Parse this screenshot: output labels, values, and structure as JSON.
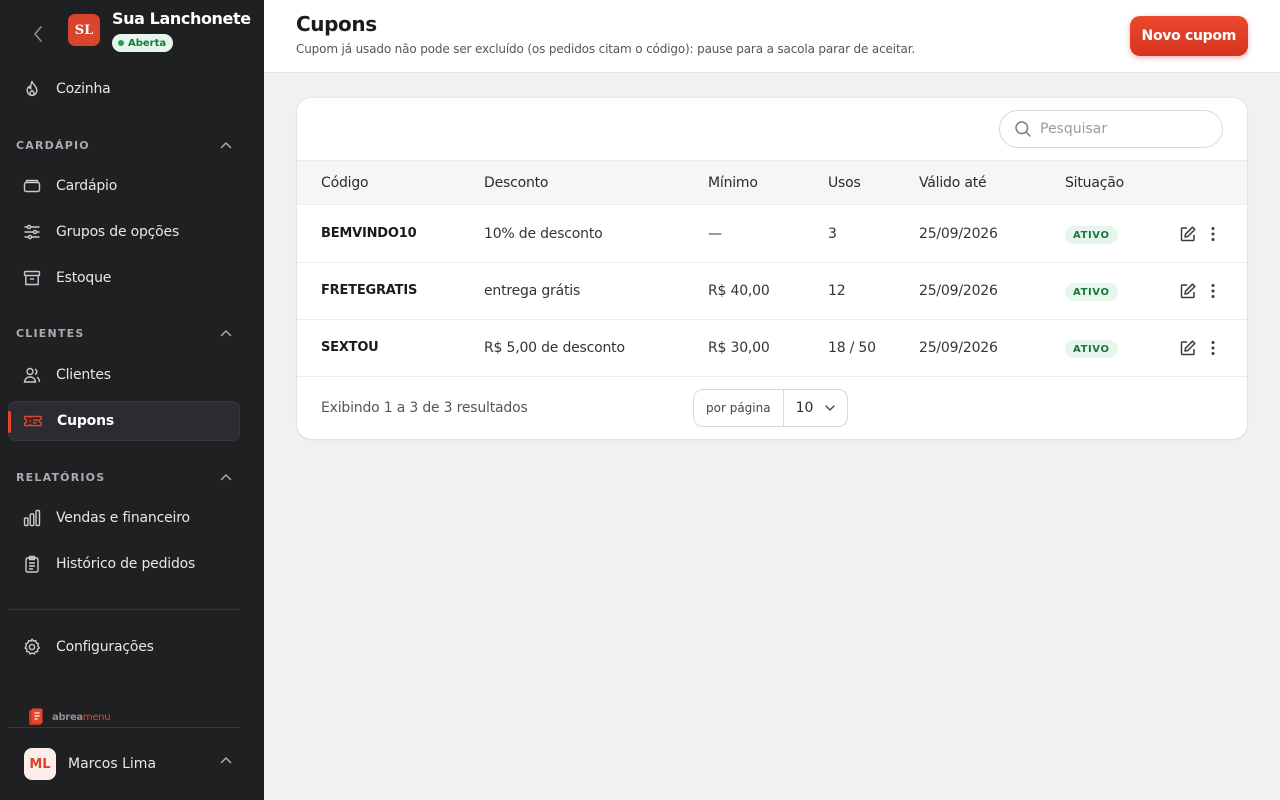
{
  "store": {
    "initials": "SL",
    "name": "Sua Lanchonete",
    "status": "Aberta"
  },
  "nav": {
    "kitchen": "Cozinha",
    "sections": [
      {
        "title": "CARDÁPIO",
        "items": [
          "Cardápio",
          "Grupos de opções",
          "Estoque"
        ]
      },
      {
        "title": "CLIENTES",
        "items": [
          "Clientes",
          "Cupons"
        ]
      },
      {
        "title": "RELATÓRIOS",
        "items": [
          "Vendas e financeiro",
          "Histórico de pedidos"
        ]
      }
    ],
    "settings": "Configurações",
    "active": "Cupons"
  },
  "brand": {
    "name_part1": "abrea",
    "name_part2": "menu"
  },
  "user": {
    "initials": "ML",
    "name": "Marcos Lima"
  },
  "header": {
    "title": "Cupons",
    "subtitle": "Cupom já usado não pode ser excluído (os pedidos citam o código): pause para a sacola parar de aceitar.",
    "new_button": "Novo cupom"
  },
  "search": {
    "placeholder": "Pesquisar"
  },
  "table": {
    "columns": [
      "Código",
      "Desconto",
      "Mínimo",
      "Usos",
      "Válido até",
      "Situação"
    ],
    "rows": [
      {
        "code": "BEMVINDO10",
        "discount": "10% de desconto",
        "minimum": "—",
        "uses": "3",
        "valid_until": "25/09/2026",
        "status": "ATIVO"
      },
      {
        "code": "FRETEGRATIS",
        "discount": "entrega grátis",
        "minimum": "R$ 40,00",
        "uses": "12",
        "valid_until": "25/09/2026",
        "status": "ATIVO"
      },
      {
        "code": "SEXTOU",
        "discount": "R$ 5,00 de desconto",
        "minimum": "R$ 30,00",
        "uses": "18 / 50",
        "valid_until": "25/09/2026",
        "status": "ATIVO"
      }
    ]
  },
  "footer": {
    "info": "Exibindo 1 a 3 de 3 resultados",
    "per_page_label": "por página",
    "per_page_value": "10"
  },
  "colors": {
    "accent": "#e8452c",
    "sidebar_bg": "#1e2022",
    "status_active_bg": "#e8f5ec",
    "status_active_text": "#137a3b"
  }
}
